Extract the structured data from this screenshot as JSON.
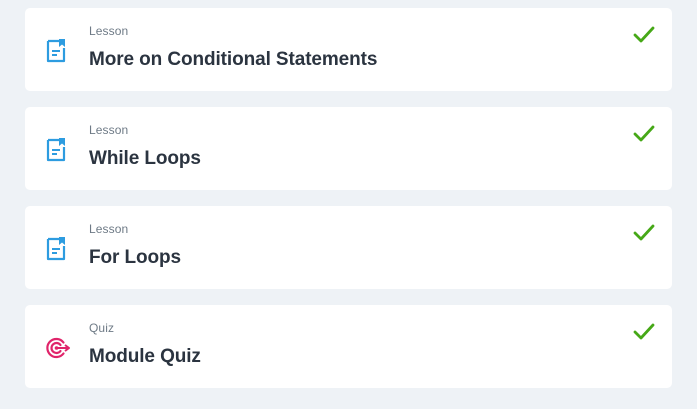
{
  "items": [
    {
      "type_label": "Lesson",
      "title": "More on Conditional Statements",
      "icon": "lesson-document-icon",
      "status": "completed"
    },
    {
      "type_label": "Lesson",
      "title": "While Loops",
      "icon": "lesson-document-icon",
      "status": "completed"
    },
    {
      "type_label": "Lesson",
      "title": "For Loops",
      "icon": "lesson-document-icon",
      "status": "completed"
    },
    {
      "type_label": "Quiz",
      "title": "Module Quiz",
      "icon": "quiz-target-icon",
      "status": "completed"
    }
  ],
  "colors": {
    "lesson_icon": "#2d9ce0",
    "quiz_icon": "#e0246a",
    "check": "#46a817",
    "background": "#eef2f6",
    "card": "#ffffff"
  }
}
